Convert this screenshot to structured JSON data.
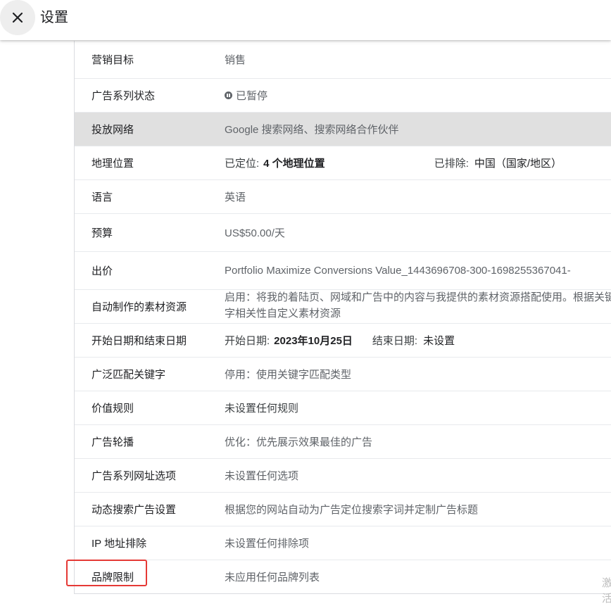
{
  "header": {
    "title": "设置"
  },
  "settings": {
    "marketing_goal": {
      "label": "营销目标",
      "value": "销售"
    },
    "campaign_status": {
      "label": "广告系列状态",
      "value": "已暂停"
    },
    "networks": {
      "label": "投放网络",
      "value": "Google 搜索网络、搜索网络合作伙伴"
    },
    "locations": {
      "label": "地理位置",
      "targeted_label": "已定位:",
      "targeted_value": "4 个地理位置",
      "excluded_label": "已排除:",
      "excluded_value": "中国（国家/地区）"
    },
    "languages": {
      "label": "语言",
      "value": "英语"
    },
    "budget": {
      "label": "预算",
      "value": "US$50.00/天"
    },
    "bidding": {
      "label": "出价",
      "value": "Portfolio Maximize Conversions Value_1443696708-300-1698255367041-"
    },
    "auto_assets": {
      "label": "自动制作的素材资源",
      "value": "启用：将我的着陆页、网域和广告中的内容与我提供的素材资源搭配使用。根据关键字相关性自定义素材资源"
    },
    "dates": {
      "label": "开始日期和结束日期",
      "start_label": "开始日期:",
      "start_value": "2023年10月25日",
      "end_label": "结束日期:",
      "end_value": "未设置"
    },
    "broad_match": {
      "label": "广泛匹配关键字",
      "value": "停用：使用关键字匹配类型"
    },
    "value_rules": {
      "label": "价值规则",
      "value": "未设置任何规则"
    },
    "ad_rotation": {
      "label": "广告轮播",
      "value": "优化：优先展示效果最佳的广告"
    },
    "url_options": {
      "label": "广告系列网址选项",
      "value": "未设置任何选项"
    },
    "dsa_settings": {
      "label": "动态搜索广告设置",
      "value": "根据您的网站自动为广告定位搜索字词并定制广告标题"
    },
    "ip_exclusions": {
      "label": "IP 地址排除",
      "value": "未设置任何排除项"
    },
    "brand_restrictions": {
      "label": "品牌限制",
      "value": "未应用任何品牌列表"
    }
  },
  "watermark": {
    "text": "激活转"
  },
  "colors": {
    "highlight_row": "#e0e0e0",
    "annotation_red": "#e53935"
  }
}
